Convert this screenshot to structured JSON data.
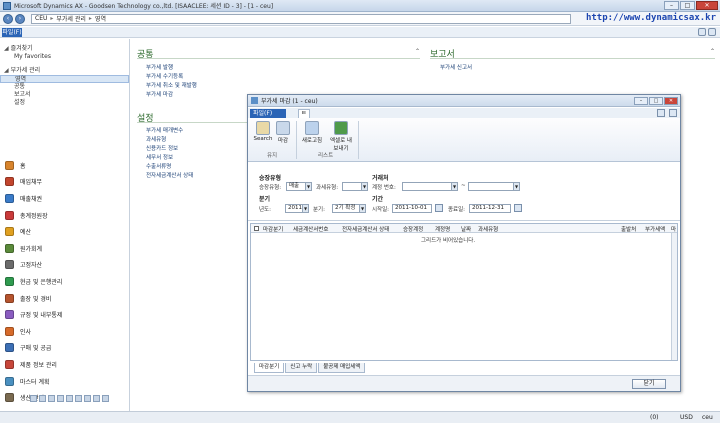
{
  "window": {
    "title": "Microsoft Dynamics AX - Goodsen Technology co.,ltd. [ISAACLEE: 세션 ID - 3] - [1 - ceu]",
    "min": "–",
    "max": "□",
    "close": "✕"
  },
  "address": {
    "company": "CEU",
    "module": "부가세 관리",
    "page": "영역",
    "brand_url": "http://www.dynamicsax.kr"
  },
  "menubar": {
    "file_label": "파일(F)"
  },
  "nav": {
    "favorites": "즐겨찾기",
    "my_favorites": "My favorites",
    "vat_mgmt": "부가세 관리",
    "subitems": [
      "영역",
      "공통",
      "보고서",
      "설정"
    ],
    "modules": [
      {
        "label": "홈",
        "color": "#d8842c"
      },
      {
        "label": "매입채무",
        "color": "#c2452d"
      },
      {
        "label": "매출채권",
        "color": "#3a7bc8"
      },
      {
        "label": "총계정원장",
        "color": "#c93a3a"
      },
      {
        "label": "예산",
        "color": "#e0a020"
      },
      {
        "label": "원가회계",
        "color": "#5a8a3a"
      },
      {
        "label": "고정자산",
        "color": "#6b6b6b"
      },
      {
        "label": "현금 및 은행관리",
        "color": "#2f9a4f"
      },
      {
        "label": "출장 및 경비",
        "color": "#b5532d"
      },
      {
        "label": "규정 및 내부통제",
        "color": "#8a5cc0"
      },
      {
        "label": "인사",
        "color": "#d66a2a"
      },
      {
        "label": "구매 및 공급",
        "color": "#3c6fb5"
      },
      {
        "label": "제품 정보 관리",
        "color": "#c7463a"
      },
      {
        "label": "마스터 계획",
        "color": "#4a90c0"
      },
      {
        "label": "생산 관리",
        "color": "#7a6a50"
      }
    ]
  },
  "content": {
    "common_heading": "공통",
    "common_links": [
      "부가세 발행",
      "부가세 수기등록",
      "부가세 취소 및 재발행",
      "부가세 마감"
    ],
    "reports_heading": "보고서",
    "report_links": [
      "부가세 신고서"
    ],
    "settings_heading": "설정",
    "settings_links": [
      "부가세 매개변수",
      "과세유형",
      "신용카드 정보",
      "세무서 정보",
      "수출서류명",
      "전자세금계산서 상태"
    ]
  },
  "dialog": {
    "title": "부가세 마감 (1 - ceu)",
    "file_label": "파일(F)",
    "tab_label": "ㅌ",
    "ribbon": {
      "search": "Search",
      "close": "마감",
      "group_maint": "유지",
      "refresh": "새로고침",
      "excel": "엑셀로 내보내기",
      "group_list": "리스트"
    },
    "filter": {
      "head_approval": "승장유형",
      "approval_type_label": "승장유형:",
      "approval_type_value": "매출",
      "tax_type_label": "과세유형:",
      "tax_type_value": "",
      "head_vendor": "거래처",
      "account_label": "계정 번호:",
      "account_value": "",
      "account_dash": "~",
      "head_quarter": "분기",
      "year_label": "년도:",
      "year_value": "2011",
      "quarter_label": "분기:",
      "quarter_value": "2기 확정",
      "head_period": "기간",
      "start_label": "시작일:",
      "start_value": "2011-10-01",
      "end_label": "종료일:",
      "end_value": "2011-12-31"
    },
    "grid": {
      "columns": [
        "마감분기",
        "세금계산서번호",
        "전자세금계산서 상태",
        "승장계정",
        "계정명",
        "날짜",
        "과세유형",
        "출발처",
        "부가세액",
        "마"
      ],
      "empty_text": "그리드가 비어있습니다."
    },
    "bottom_tabs": [
      "마감분기",
      "신고 누락",
      "불공제 매입세액"
    ],
    "close_button": "닫기"
  },
  "status": {
    "msg_count": "(0)",
    "currency": "USD",
    "company": "ceu"
  }
}
